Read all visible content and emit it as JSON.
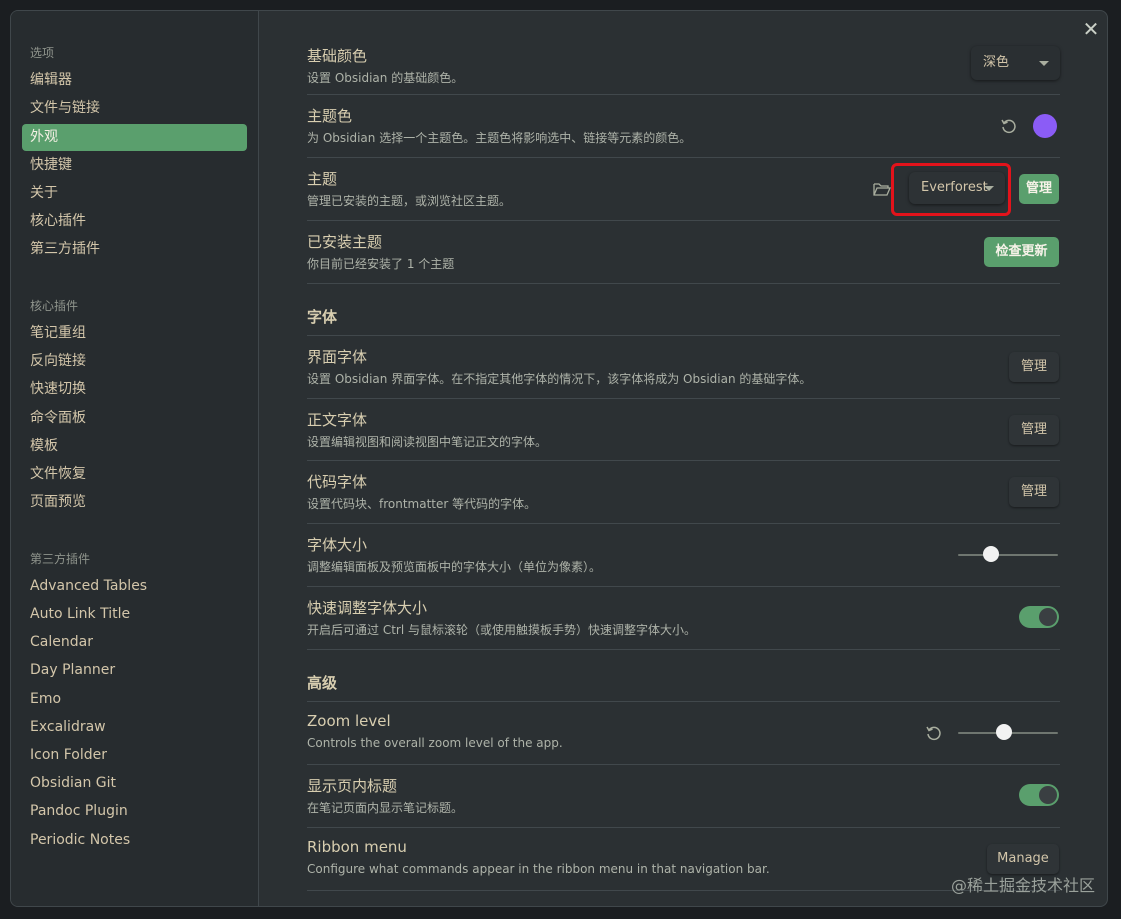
{
  "sidebar": {
    "group_options": "选项",
    "options": [
      "编辑器",
      "文件与链接",
      "外观",
      "快捷键",
      "关于",
      "核心插件",
      "第三方插件"
    ],
    "group_core": "核心插件",
    "core": [
      "笔记重组",
      "反向链接",
      "快速切换",
      "命令面板",
      "模板",
      "文件恢复",
      "页面预览"
    ],
    "group_third": "第三方插件",
    "third": [
      "Advanced Tables",
      "Auto Link Title",
      "Calendar",
      "Day Planner",
      "Emo",
      "Excalidraw",
      "Icon Folder",
      "Obsidian Git",
      "Pandoc Plugin",
      "Periodic Notes"
    ]
  },
  "settings": {
    "base_color": {
      "title": "基础颜色",
      "desc": "设置 Obsidian 的基础颜色。",
      "value": "深色"
    },
    "accent_color": {
      "title": "主题色",
      "desc": "为 Obsidian 选择一个主题色。主题色将影响选中、链接等元素的颜色。",
      "color": "#8b5cf6"
    },
    "theme": {
      "title": "主题",
      "desc": "管理已安装的主题，或浏览社区主题。",
      "value": "Everforest",
      "manage": "管理"
    },
    "installed": {
      "title": "已安装主题",
      "desc": "你目前已经安装了 1 个主题",
      "check": "检查更新"
    },
    "font_section": "字体",
    "ui_font": {
      "title": "界面字体",
      "desc": "设置 Obsidian 界面字体。在不指定其他字体的情况下，该字体将成为 Obsidian 的基础字体。",
      "manage": "管理"
    },
    "text_font": {
      "title": "正文字体",
      "desc": "设置编辑视图和阅读视图中笔记正文的字体。",
      "manage": "管理"
    },
    "code_font": {
      "title": "代码字体",
      "desc": "设置代码块、frontmatter 等代码的字体。",
      "manage": "管理"
    },
    "font_size": {
      "title": "字体大小",
      "desc": "调整编辑面板及预览面板中的字体大小（单位为像素）。",
      "level": 0.33
    },
    "quick_font": {
      "title": "快速调整字体大小",
      "desc": "开启后可通过 Ctrl 与鼠标滚轮（或使用触摸板手势）快速调整字体大小。",
      "on": true
    },
    "advanced_section": "高级",
    "zoom": {
      "title": "Zoom level",
      "desc": "Controls the overall zoom level of the app.",
      "level": 0.46
    },
    "inline_title": {
      "title": "显示页内标题",
      "desc": "在笔记页面内显示笔记标题。",
      "on": true
    },
    "ribbon": {
      "title": "Ribbon menu",
      "desc": "Configure what commands appear in the ribbon menu in that navigation bar.",
      "manage": "Manage"
    }
  },
  "watermark": "@稀土掘金技术社区",
  "colors": {
    "accent": "#5a9f6d",
    "highlight": "#e3131b"
  }
}
